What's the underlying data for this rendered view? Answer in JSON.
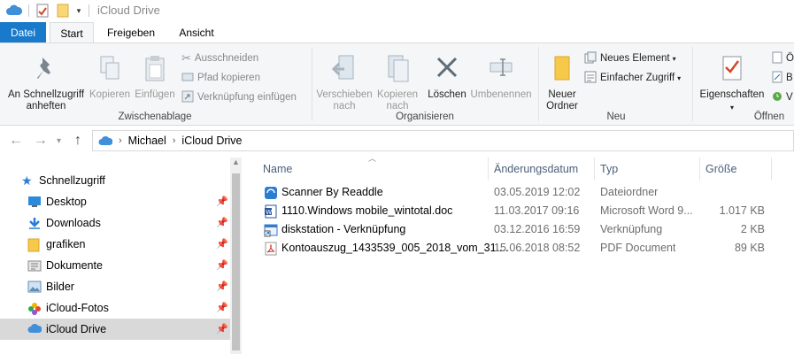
{
  "window": {
    "title": "iCloud Drive"
  },
  "ribbon_tabs": [
    {
      "label": "Datei"
    },
    {
      "label": "Start"
    },
    {
      "label": "Freigeben"
    },
    {
      "label": "Ansicht"
    }
  ],
  "ribbon": {
    "pin_quick_access": "An Schnellzugriff\nanheften",
    "copy": "Kopieren",
    "paste": "Einfügen",
    "cut": "Ausschneiden",
    "copy_path": "Pfad kopieren",
    "paste_shortcut": "Verknüpfung einfügen",
    "clipboard_group": "Zwischenablage",
    "move_to": "Verschieben\nnach",
    "copy_to": "Kopieren\nnach",
    "delete": "Löschen",
    "rename": "Umbenennen",
    "organize_group": "Organisieren",
    "new_folder": "Neuer\nOrdner",
    "new_item": "Neues Element",
    "easy_access": "Einfacher Zugriff",
    "new_group": "Neu",
    "properties": "Eigenschaften",
    "open_group": "Öffnen",
    "open_trunc": "Ö",
    "edit_trunc": "B",
    "history_trunc": "V"
  },
  "address": {
    "crumbs": [
      "Michael",
      "iCloud Drive"
    ]
  },
  "sidebar": {
    "quick_access": "Schnellzugriff",
    "items": [
      {
        "label": "Desktop",
        "icon": "desktop-icon"
      },
      {
        "label": "Downloads",
        "icon": "download-icon"
      },
      {
        "label": "grafiken",
        "icon": "folder-icon"
      },
      {
        "label": "Dokumente",
        "icon": "documents-icon"
      },
      {
        "label": "Bilder",
        "icon": "pictures-icon"
      },
      {
        "label": "iCloud-Fotos",
        "icon": "photos-icon"
      },
      {
        "label": "iCloud Drive",
        "icon": "cloud-icon"
      }
    ]
  },
  "columns": {
    "name": "Name",
    "date": "Änderungsdatum",
    "type": "Typ",
    "size": "Größe"
  },
  "files": [
    {
      "name": "Scanner By Readdle",
      "date": "03.05.2019 12:02",
      "type": "Dateiordner",
      "size": "",
      "icon": "scanner-folder-icon"
    },
    {
      "name": "1110.Windows mobile_wintotal.doc",
      "date": "11.03.2017 09:16",
      "type": "Microsoft Word 9...",
      "size": "1.017 KB",
      "icon": "word-doc-icon"
    },
    {
      "name": "diskstation - Verknüpfung",
      "date": "03.12.2016 16:59",
      "type": "Verknüpfung",
      "size": "2 KB",
      "icon": "shortcut-icon"
    },
    {
      "name": "Kontoauszug_1433539_005_2018_vom_31....",
      "date": "15.06.2018 08:52",
      "type": "PDF Document",
      "size": "89 KB",
      "icon": "pdf-icon"
    }
  ],
  "colors": {
    "file_tab": "#1979ca",
    "header_text": "#4c607a",
    "selection": "#d9d9d9"
  }
}
